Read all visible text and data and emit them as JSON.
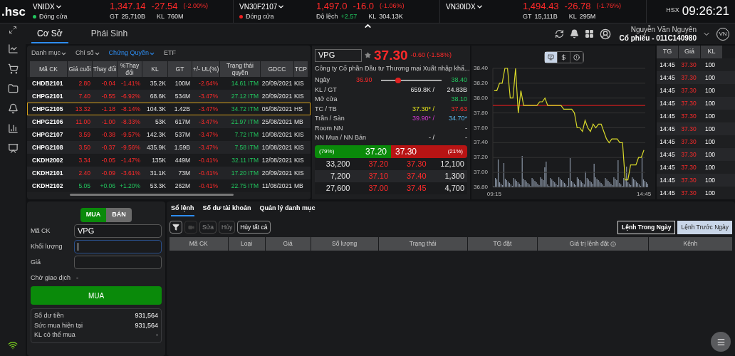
{
  "logo": ".hsc",
  "indices": [
    {
      "name": "VNIDX",
      "value": "1,347.14",
      "change": "-27.54",
      "pct": "(-2.00%)",
      "kind": "down",
      "status": {
        "label": "Đóng cửa",
        "color": "#22c55e"
      },
      "stats": [
        {
          "label": "GT",
          "value": "25,710B",
          "kind": "plain"
        },
        {
          "label": "KL",
          "value": "760M",
          "kind": "plain"
        }
      ]
    },
    {
      "name": "VN30F2107",
      "value": "1,497.0",
      "change": "-16.0",
      "pct": "(-1.06%)",
      "kind": "down",
      "status": {
        "label": "Đóng cửa",
        "color": "#ef2020"
      },
      "stats": [
        {
          "label": "Độ lệch",
          "value": "+2.57",
          "kind": "up"
        },
        {
          "label": "KL",
          "value": "304.13K",
          "kind": "plain"
        }
      ]
    },
    {
      "name": "VN30IDX",
      "value": "1,494.43",
      "change": "-26.78",
      "pct": "(-1.76%)",
      "kind": "down",
      "stats": [
        {
          "label": "GT",
          "value": "15,111B",
          "kind": "plain"
        },
        {
          "label": "KL",
          "value": "295M",
          "kind": "plain"
        }
      ]
    }
  ],
  "exchange": "HSX",
  "clock": "09:26:21",
  "market_tabs": [
    {
      "label": "Cơ Sở",
      "selected": true
    },
    {
      "label": "Phái Sinh",
      "selected": false
    }
  ],
  "user": {
    "name": "Nguyễn Văn Nguyên",
    "account": "Cổ phiếu - 011C140980",
    "language": "VN"
  },
  "watchlist": {
    "tabs": [
      {
        "label": "Danh mục",
        "dropdown": true,
        "selected": false
      },
      {
        "label": "Chỉ số",
        "dropdown": true,
        "selected": false
      },
      {
        "label": "Chứng Quyền",
        "dropdown": true,
        "selected": true
      },
      {
        "label": "ETF",
        "dropdown": false,
        "selected": false
      }
    ],
    "columns": [
      "Mã CK",
      "Giá cuối",
      "Thay đổi",
      "%Thay đổi",
      "KL",
      "GT",
      "+/- UL(%)",
      "Trạng thái quyền",
      "GDCC",
      "TCP"
    ],
    "rows": [
      {
        "cells": [
          "CHDB2101",
          "2.80",
          "-0.04",
          "-1.41%",
          "35.2K",
          "100M",
          "-2.64%",
          "14.61 ITM",
          "20/09/2021",
          "KIS"
        ],
        "kind": "down",
        "selected": false
      },
      {
        "cells": [
          "CHPG2101",
          "7.40",
          "-0.55",
          "-6.92%",
          "68.6K",
          "534M",
          "-3.47%",
          "27.12 ITM",
          "20/09/2021",
          "KIS"
        ],
        "kind": "down",
        "selected": false
      },
      {
        "cells": [
          "CHPG2105",
          "13.32",
          "-1.18",
          "-8.14%",
          "104.3K",
          "1.42B",
          "-3.47%",
          "34.72 ITM",
          "05/08/2021",
          "HS"
        ],
        "kind": "down",
        "selected": true
      },
      {
        "cells": [
          "CHPG2106",
          "11.00",
          "-1.00",
          "-8.33%",
          "53K",
          "617M",
          "-3.47%",
          "21.97 ITM",
          "25/08/2021",
          "MB"
        ],
        "kind": "down",
        "selected": false
      },
      {
        "cells": [
          "CHPG2107",
          "3.59",
          "-0.38",
          "-9.57%",
          "142.3K",
          "537M",
          "-3.47%",
          "7.72 ITM",
          "10/08/2021",
          "KIS"
        ],
        "kind": "down",
        "selected": false
      },
      {
        "cells": [
          "CHPG2108",
          "3.50",
          "-0.37",
          "-9.56%",
          "435.9K",
          "1.59B",
          "-3.47%",
          "7.58 ITM",
          "10/08/2021",
          "KIS"
        ],
        "kind": "down",
        "selected": false
      },
      {
        "cells": [
          "CKDH2002",
          "3.34",
          "-0.05",
          "-1.47%",
          "135K",
          "449M",
          "-0.41%",
          "32.11 ITM",
          "12/08/2021",
          "KIS"
        ],
        "kind": "down",
        "selected": false
      },
      {
        "cells": [
          "CKDH2101",
          "2.40",
          "-0.09",
          "-3.61%",
          "31.1K",
          "73M",
          "-0.41%",
          "17.20 ITM",
          "20/09/2021",
          "KIS"
        ],
        "kind": "down",
        "selected": false
      },
      {
        "cells": [
          "CKDH2102",
          "5.05",
          "+0.06",
          "+1.20%",
          "53.3K",
          "262M",
          "-0.41%",
          "22.75 ITM",
          "11/08/2021",
          "MB"
        ],
        "kind": "up",
        "selected": false
      }
    ]
  },
  "quote": {
    "symbol": "VPG",
    "price": "37.30",
    "change": "-0.60 (-1.58%)",
    "company": "Công ty Cổ phần Đầu tư Thương mại Xuất nhập khẩ...",
    "day_range": {
      "label": "Ngày",
      "low": "36.90",
      "high": "38.40",
      "level": 0.28
    },
    "stats": [
      {
        "label": "KL / GT",
        "values": [
          {
            "text": "659.8K /",
            "kind": "plain"
          },
          {
            "text": "24.83B",
            "kind": "plain"
          }
        ]
      },
      {
        "label": "Mở cửa",
        "values": [
          {
            "text": "38.10",
            "kind": "up"
          }
        ]
      },
      {
        "label": "TC / TB",
        "values": [
          {
            "text": "37.30* /",
            "kind": "ref"
          },
          {
            "text": "37.63",
            "kind": "down"
          }
        ]
      },
      {
        "label": "Trần / Sàn",
        "values": [
          {
            "text": "39.90* /",
            "kind": "ceil"
          },
          {
            "text": "34.70*",
            "kind": "floor"
          }
        ]
      },
      {
        "label": "Room NN",
        "values": [
          {
            "text": "-",
            "kind": "plain"
          }
        ]
      },
      {
        "label": "NN Mua / NN Bán",
        "values": [
          {
            "text": "- /",
            "kind": "plain"
          },
          {
            "text": "-",
            "kind": "plain"
          }
        ]
      }
    ],
    "bid_pct": "(79%)",
    "bid": "37.20",
    "ask": "37.30",
    "ask_pct": "(21%)",
    "book": [
      [
        "33,200",
        "37.20",
        "37.30",
        "12,100"
      ],
      [
        "7,200",
        "37.10",
        "37.40",
        "1,300"
      ],
      [
        "27,600",
        "37.00",
        "37.45",
        "4,700"
      ]
    ]
  },
  "chart": {
    "views": [
      {
        "selected": true
      },
      {
        "selected": false
      },
      {
        "selected": false
      }
    ],
    "chart_data": {
      "type": "line",
      "categories": [
        "09:15",
        null,
        null,
        null,
        null,
        null,
        null,
        null,
        null,
        null,
        null,
        null,
        null,
        null,
        null,
        null,
        null,
        null,
        null,
        null,
        null,
        null,
        null,
        null,
        null,
        null,
        null,
        null,
        null,
        null,
        null,
        null,
        null,
        null,
        null,
        null,
        null,
        null,
        null,
        null,
        null,
        null,
        null,
        null,
        null,
        null,
        null,
        null,
        null,
        null,
        null,
        null,
        null,
        null,
        null,
        null,
        "14:45"
      ],
      "series": [
        {
          "color": "#d9d92a",
          "values": [
            38.1,
            38.1,
            38.2,
            38.2,
            38.4,
            38.4,
            38.0,
            38.0,
            38.4,
            37.8,
            38.1,
            37.9,
            37.9,
            37.9,
            37.9,
            37.9,
            37.9,
            37.95,
            37.95,
            38.0,
            37.9,
            37.9,
            37.9,
            37.9,
            37.9,
            37.9,
            37.85,
            37.85,
            37.85,
            37.85,
            37.8,
            37.6,
            37.6,
            37.55,
            37.7,
            37.6,
            37.55,
            37.65,
            37.6,
            37.65,
            37.65,
            37.55,
            37.45,
            37.4,
            37.45,
            37.45,
            37.45,
            37.4,
            37.4,
            36.9,
            36.9,
            37.1,
            37.1,
            37.1,
            37.2,
            37.2,
            37.3
          ]
        }
      ],
      "ylim": [
        36.8,
        38.4
      ],
      "yticks": [
        {
          "value": 38.4,
          "label": "38.40"
        },
        {
          "value": 38.2,
          "label": "38.20"
        },
        {
          "value": 38.0,
          "label": "38.00"
        },
        {
          "value": 37.8,
          "label": "37.80"
        },
        {
          "value": 37.6,
          "label": "37.60"
        },
        {
          "value": 37.4,
          "label": "37.40"
        },
        {
          "value": 37.2,
          "label": "37.20"
        },
        {
          "value": 37.0,
          "label": "37.00"
        },
        {
          "value": 36.8,
          "label": "36.80"
        }
      ],
      "grid": true,
      "ref_lines": [
        {
          "axis": "y",
          "value": 37.9
        }
      ]
    }
  },
  "trades": {
    "columns": [
      "TG",
      "Giá",
      "KL"
    ],
    "rows": [
      [
        "14:45",
        "37.30",
        "100"
      ],
      [
        "14:45",
        "37.30",
        "100"
      ],
      [
        "14:45",
        "37.30",
        "100"
      ],
      [
        "14:45",
        "37.30",
        "100"
      ],
      [
        "14:45",
        "37.30",
        "100"
      ],
      [
        "14:45",
        "37.30",
        "100"
      ],
      [
        "14:45",
        "37.30",
        "100"
      ],
      [
        "14:45",
        "37.30",
        "100"
      ],
      [
        "14:45",
        "37.30",
        "100"
      ],
      [
        "14:45",
        "37.30",
        "100"
      ],
      [
        "14:45",
        "37.30",
        "100"
      ]
    ]
  },
  "order_form": {
    "sides": [
      {
        "label": "MUA",
        "selected": true
      },
      {
        "label": "BÁN",
        "selected": false
      }
    ],
    "fields": [
      {
        "label": "Mã CK",
        "value": "VPG",
        "focused": false
      },
      {
        "label": "Khối lượng",
        "focused": true
      },
      {
        "label": "Giá",
        "focused": false
      }
    ],
    "status_label": "Chờ giao dịch",
    "status_value": "-",
    "submit": "MUA",
    "summary": [
      {
        "label": "Số dư tiền",
        "value": "931,564"
      },
      {
        "label": "Sức mua hiện tại",
        "value": "931,564"
      },
      {
        "label": "KL có thể mua",
        "value": "-"
      }
    ]
  },
  "orders": {
    "tabs": [
      {
        "label": "Sổ lệnh",
        "selected": true
      },
      {
        "label": "Số dư tài khoản",
        "selected": false
      },
      {
        "label": "Quản lý danh mục",
        "selected": false
      }
    ],
    "actions": [
      {
        "label": "Sửa",
        "disabled": true
      },
      {
        "label": "Hủy",
        "disabled": true
      },
      {
        "label": "Hủy tất cả",
        "disabled": false
      }
    ],
    "views": [
      {
        "label": "Lệnh Trong Ngày",
        "selected": false
      },
      {
        "label": "Lệnh Trước Ngày",
        "selected": true
      }
    ],
    "columns": [
      "Mã CK",
      "Loại",
      "Giá",
      "Số lượng",
      "Trạng thái",
      "TG đặt",
      "Giá trị lệnh đặt",
      "Kênh"
    ]
  }
}
